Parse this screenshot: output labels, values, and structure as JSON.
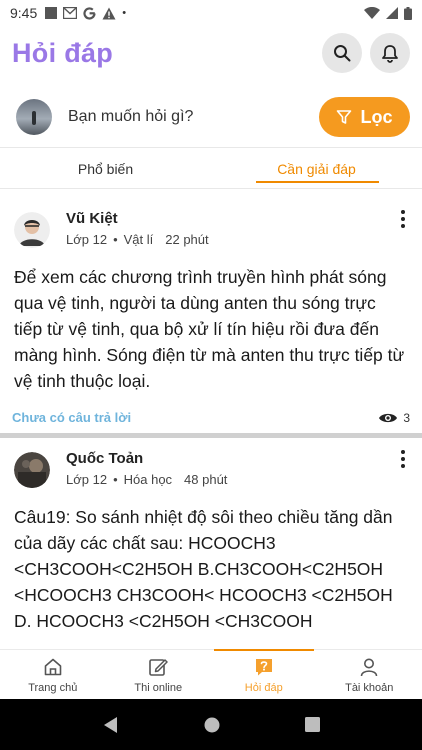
{
  "status_bar": {
    "time": "9:45",
    "dot": "•"
  },
  "header": {
    "title": "Hỏi đáp",
    "search_icon": "search-icon",
    "bell_icon": "bell-icon"
  },
  "ask": {
    "placeholder": "Bạn muốn hỏi gì?",
    "filter_label": "Lọc"
  },
  "tabs": [
    {
      "label": "Phổ biến",
      "active": false
    },
    {
      "label": "Cần giải đáp",
      "active": true
    }
  ],
  "posts": [
    {
      "author": "Vũ Kiệt",
      "grade": "Lớp 12",
      "sep": "•",
      "subject": "Vật lí",
      "time": "22 phút",
      "body": "Để xem các chương trình truyền hình phát sóng qua vệ tinh, người ta dùng anten thu sóng trực tiếp từ vệ tinh, qua bộ xử lí tín hiệu rồi đưa đến màng hình. Sóng điện từ mà anten thu trực tiếp từ vệ tinh thuộc loại.",
      "status": "Chưa có câu trả lời",
      "views": "3"
    },
    {
      "author": "Quốc Toản",
      "grade": "Lớp 12",
      "sep": "•",
      "subject": "Hóa học",
      "time": "48 phút",
      "body": "Câu19: So sánh nhiệt độ sôi theo chiều tăng dần của dãy các chất sau: HCOOCH3 <CH3COOH<C2H5OH B.CH3COOH<C2H5OH <HCOOCH3 CH3COOH< HCOOCH3 <C2H5OH D. HCOOCH3 <C2H5OH <CH3COOH"
    }
  ],
  "bottom_nav": [
    {
      "label": "Trang chủ",
      "icon": "home-icon",
      "active": false
    },
    {
      "label": "Thi online",
      "icon": "edit-icon",
      "active": false
    },
    {
      "label": "Hỏi đáp",
      "icon": "question-chat-icon",
      "active": true
    },
    {
      "label": "Tài khoản",
      "icon": "user-icon",
      "active": false
    }
  ],
  "colors": {
    "title": "#9a78e6",
    "accent": "#f59a1f",
    "link": "#6fb4dc"
  }
}
